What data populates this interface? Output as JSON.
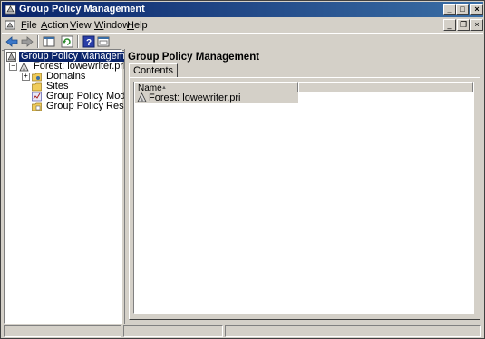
{
  "window": {
    "title": "Group Policy Management",
    "controls": {
      "minimize": "_",
      "maximize": "□",
      "close": "×"
    }
  },
  "menu": [
    {
      "accel": "F",
      "rest": "ile"
    },
    {
      "accel": "A",
      "rest": "ction"
    },
    {
      "accel": "V",
      "rest": "iew"
    },
    {
      "accel": "W",
      "rest": "indow"
    },
    {
      "accel": "H",
      "rest": "elp"
    }
  ],
  "mdi": {
    "minimize": "_",
    "restore": "❐",
    "close": "×"
  },
  "toolbar": [
    "back-icon",
    "forward-icon",
    "show-hide-tree-icon",
    "refresh-icon",
    "help-icon",
    "properties-icon"
  ],
  "tree": {
    "root": "Group Policy Management",
    "forest": "Forest: lowewriter.pri",
    "children": [
      "Domains",
      "Sites",
      "Group Policy Modeling",
      "Group Policy Results"
    ],
    "expander_plus": "+",
    "expander_minus": "−"
  },
  "right": {
    "title": "Group Policy Management",
    "tab": "Contents",
    "column_name": "Name",
    "sort_arrow": "▲",
    "rows": [
      "Forest: lowewriter.pri"
    ]
  },
  "colors": {
    "title_start": "#0a246a",
    "title_end": "#3a6ea5",
    "chrome": "#d4d0c8"
  }
}
